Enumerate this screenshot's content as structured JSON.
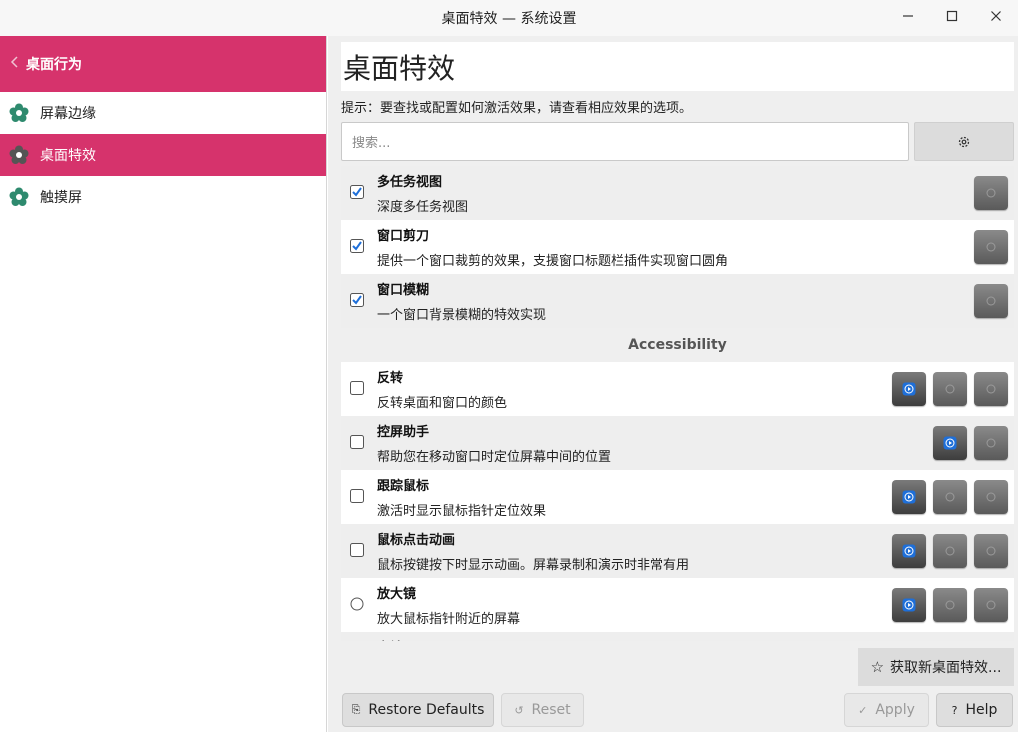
{
  "window": {
    "title": "桌面特效 — 系统设置",
    "minimize": "–",
    "maximize": "☐",
    "close": "✕"
  },
  "sidebar": {
    "back_label": "桌面行为",
    "items": [
      {
        "label": "屏幕边缘",
        "icon": "flower-icon"
      },
      {
        "label": "桌面特效",
        "icon": "flower-icon"
      },
      {
        "label": "触摸屏",
        "icon": "flower-icon"
      }
    ],
    "accent": "#d6336c"
  },
  "main": {
    "title": "桌面特效",
    "hint": "提示：要查找或配置如何激活效果，请查看相应效果的选项。",
    "search_placeholder": "搜索...",
    "section_accessibility": "Accessibility",
    "effects": [
      {
        "name": "多任务视图",
        "desc": "深度多任务视图",
        "checked": true
      },
      {
        "name": "窗口剪刀",
        "desc": "提供一个窗口裁剪的效果，支援窗口标题栏插件实现窗口圆角",
        "checked": true
      },
      {
        "name": "窗口模糊",
        "desc": "一个窗口背景模糊的特效实现",
        "checked": true
      },
      {
        "name": "反转",
        "desc": "反转桌面和窗口的颜色",
        "checked": false
      },
      {
        "name": "控屏助手",
        "desc": "帮助您在移动窗口时定位屏幕中间的位置",
        "checked": false
      },
      {
        "name": "跟踪鼠标",
        "desc": "激活时显示鼠标指针定位效果",
        "checked": false
      },
      {
        "name": "鼠标点击动画",
        "desc": "鼠标按键按下时显示动画。屏幕录制和演示时非常有用",
        "checked": false
      },
      {
        "name": "放大镜",
        "desc": "放大鼠标指针附近的屏幕",
        "checked": false
      },
      {
        "name": "空镜",
        "desc": "",
        "checked": false
      }
    ],
    "get_new": "获取新桌面特效..."
  },
  "footer": {
    "restore_defaults": "Restore Defaults",
    "reset": "Reset",
    "apply": "Apply",
    "help": "Help"
  }
}
